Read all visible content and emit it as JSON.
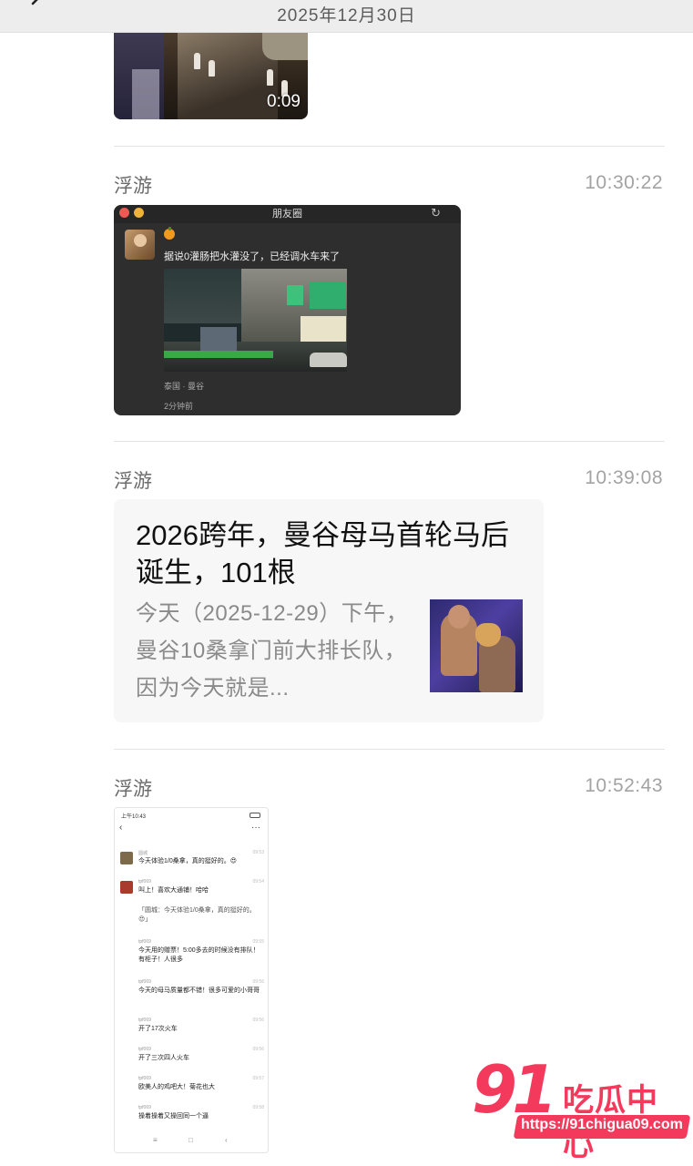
{
  "header": {
    "date": "2025年12月30日",
    "back_icon": "chevron-left-icon"
  },
  "video": {
    "duration": "0:09"
  },
  "messages": [
    {
      "sender": "浮游",
      "time": "10:30:22",
      "moments": {
        "window_title": "朋友圈",
        "text": "据说0灌肠把水灌没了，已经调水车来了",
        "location": "泰国 · 曼谷",
        "ago": "2分钟前"
      }
    },
    {
      "sender": "浮游",
      "time": "10:39:08",
      "article": {
        "title": "2026跨年，曼谷母马首轮马后诞生，101根",
        "desc": "今天（2025-12-29）下午，曼谷10桑拿门前大排长队，因为今天就是..."
      }
    },
    {
      "sender": "浮游",
      "time": "10:52:43",
      "chat_shot": {
        "status_time": "上午10:43",
        "items": [
          {
            "name": "圆城",
            "time": "09:53",
            "text": "今天体验1/0桑拿，真的挺好的。😍"
          },
          {
            "name": "tpf069",
            "time": "09:54",
            "text": "叫上！喜欢大通铺！哈哈"
          },
          {
            "name": "",
            "time": "",
            "text": "「圆城：今天体验1/0桑拿，真的挺好的。😍」"
          },
          {
            "name": "tpf069",
            "time": "09:55",
            "text": "今天用的赠票！5:00多去的时候没有排队！有柜子！人很多"
          },
          {
            "name": "tpf069",
            "time": "09:56",
            "text": "今天的母马质量都不错！很多可爱的小哥哥"
          },
          {
            "name": "tpf069",
            "time": "09:56",
            "text": "开了17次火车"
          },
          {
            "name": "tpf069",
            "time": "09:56",
            "text": "开了三次四人火车"
          },
          {
            "name": "tpf069",
            "time": "09:57",
            "text": "欧美人的鸡吧大！菊花也大"
          },
          {
            "name": "tpf069",
            "time": "09:58",
            "text": "操着操着又操回同一个逼"
          }
        ]
      }
    }
  ],
  "watermark": {
    "num": "91",
    "name": "吃瓜中心",
    "url": "https://91chigua09.com"
  }
}
